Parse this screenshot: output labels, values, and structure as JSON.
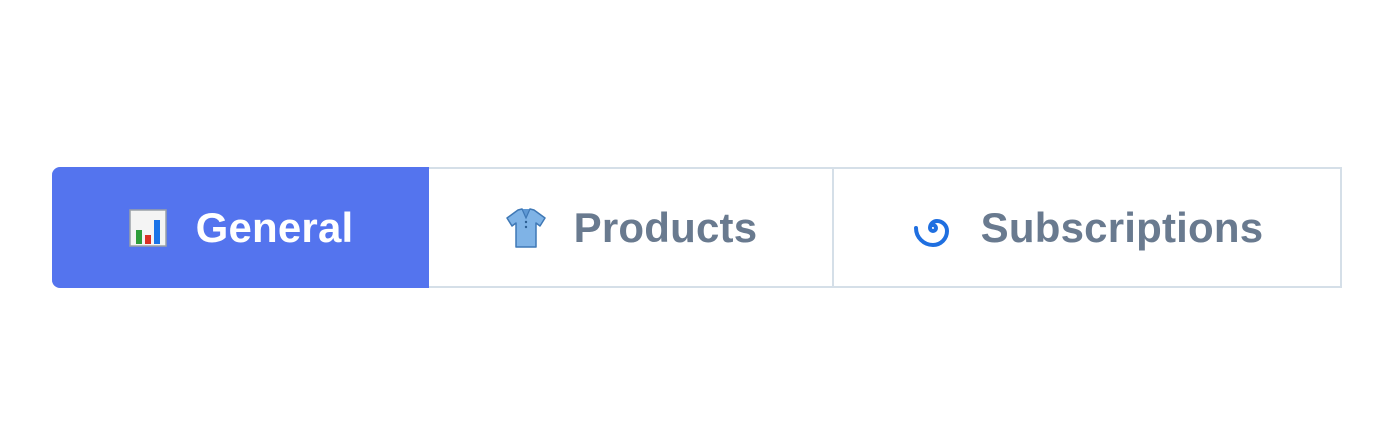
{
  "tabs": [
    {
      "label": "General",
      "icon": "bar-chart-icon",
      "active": true
    },
    {
      "label": "Products",
      "icon": "shirt-icon",
      "active": false
    },
    {
      "label": "Subscriptions",
      "icon": "cyclone-icon",
      "active": false
    }
  ],
  "colors": {
    "active_bg": "#5474ee",
    "active_text": "#ffffff",
    "inactive_text": "#697a8f",
    "border": "#d5dfe8"
  }
}
